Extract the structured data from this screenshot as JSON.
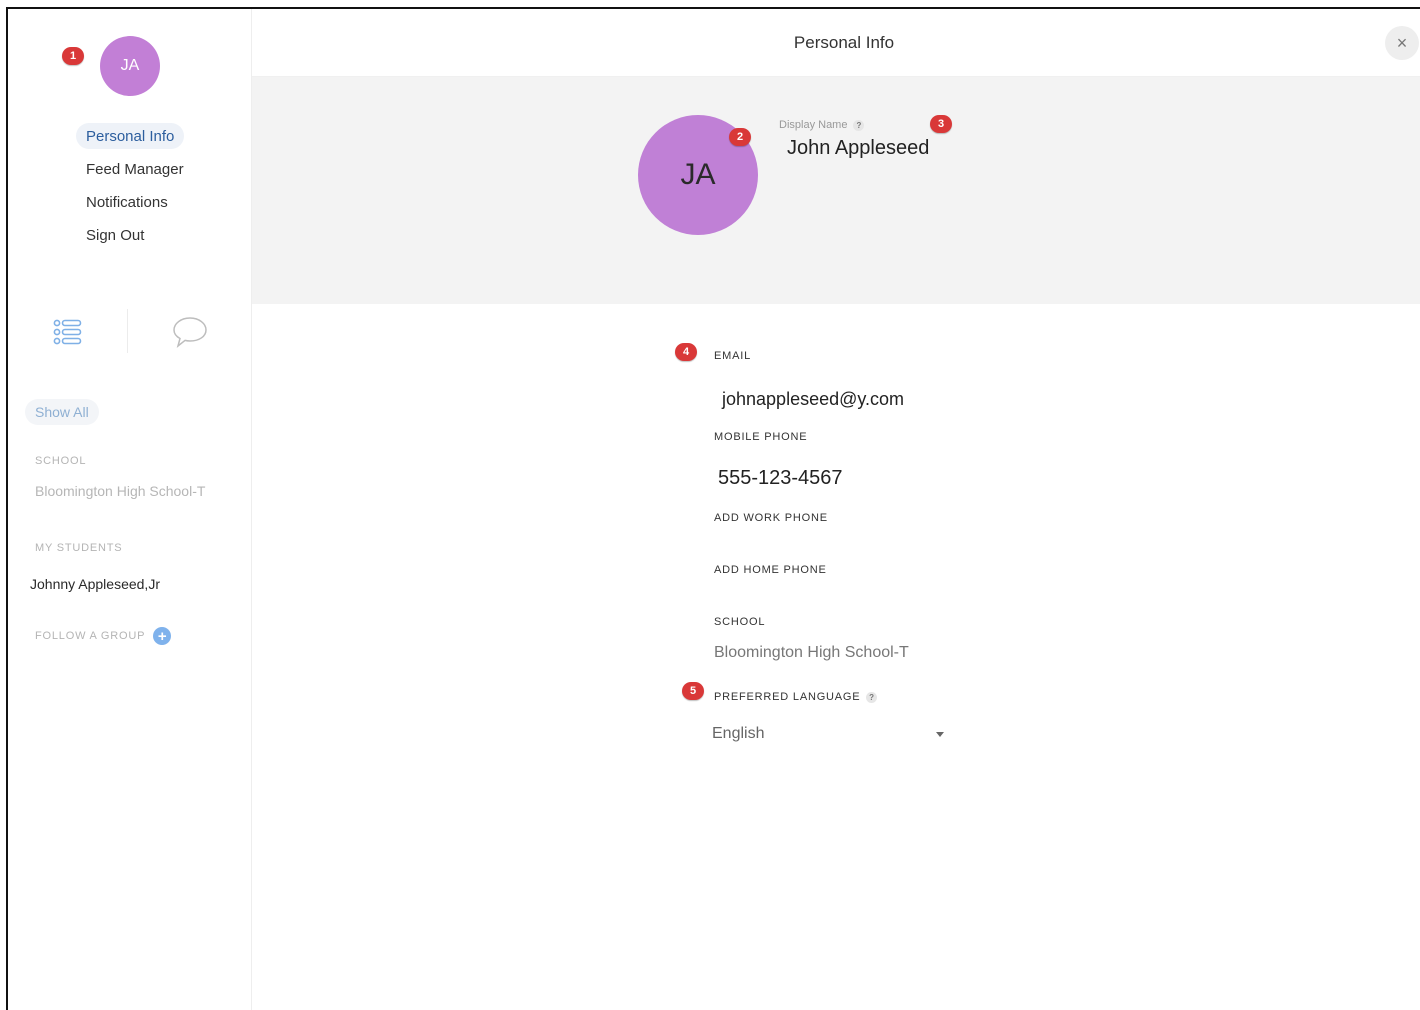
{
  "sidebar": {
    "avatar_initials": "JA",
    "badge_1": "1",
    "nav": [
      {
        "label": "Personal Info",
        "active": true
      },
      {
        "label": "Feed Manager",
        "active": false
      },
      {
        "label": "Notifications",
        "active": false
      },
      {
        "label": "Sign Out",
        "active": false
      }
    ],
    "show_all": "Show All",
    "school_caption": "SCHOOL",
    "school_value": "Bloomington High School-T",
    "students_caption": "MY STUDENTS",
    "student_name": "Johnny Appleseed,Jr",
    "follow_group_label": "FOLLOW A GROUP",
    "follow_plus": "+"
  },
  "header": {
    "title": "Personal Info",
    "close": "×"
  },
  "profile": {
    "avatar_initials": "JA",
    "badge_2": "2",
    "badge_3": "3",
    "display_name_label": "Display Name",
    "help": "?",
    "display_name": "John Appleseed"
  },
  "form": {
    "badge_4": "4",
    "badge_5": "5",
    "email_label": "EMAIL",
    "email_value": "johnappleseed@y.com",
    "mobile_label": "MOBILE PHONE",
    "mobile_value": "555-123-4567",
    "work_phone_label": "ADD WORK PHONE",
    "home_phone_label": "ADD HOME PHONE",
    "school_label": "SCHOOL",
    "school_value": "Bloomington High School-T",
    "language_label": "PREFERRED LANGUAGE",
    "help": "?",
    "language_value": "English"
  },
  "colors": {
    "avatar": "#c080d6",
    "badge": "#d93838",
    "active_nav_text": "#2c5e9e",
    "accent_icon": "#8fb0d3"
  }
}
